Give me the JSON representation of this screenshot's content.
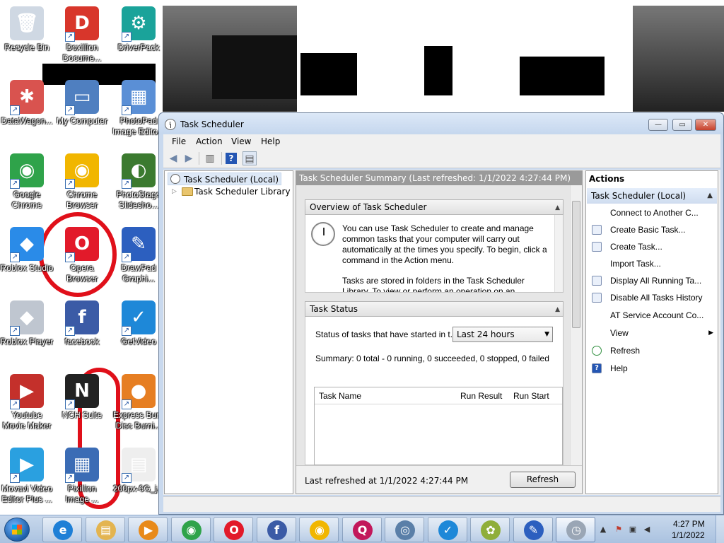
{
  "desktop": {
    "icons": [
      {
        "label": "Recycle Bin",
        "color": "#cfd8e3",
        "glyph": "🗑"
      },
      {
        "label": "Doxillion Docume...",
        "color": "#d8362b",
        "glyph": "D"
      },
      {
        "label": "DriverPack",
        "color": "#1aa39a",
        "glyph": "⚙"
      },
      {
        "label": "DataWagon...",
        "color": "#d9534f",
        "glyph": "✱"
      },
      {
        "label": "My Computer",
        "color": "#4f7fc0",
        "glyph": "▭"
      },
      {
        "label": "PhotoPad Image Edito...",
        "color": "#5a8fd6",
        "glyph": "▦"
      },
      {
        "label": "Google Chrome",
        "color": "#2fa34a",
        "glyph": "◉"
      },
      {
        "label": "Chrome Browser",
        "color": "#f1b600",
        "glyph": "◉"
      },
      {
        "label": "PhotoStage Slidesho...",
        "color": "#3b7a2f",
        "glyph": "◐"
      },
      {
        "label": "Roblox Studio",
        "color": "#2a8be8",
        "glyph": "◆"
      },
      {
        "label": "Opera Browser",
        "color": "#e21a2a",
        "glyph": "O"
      },
      {
        "label": "DrawPad Graphi...",
        "color": "#2c5fbf",
        "glyph": "✎"
      },
      {
        "label": "Roblox Player",
        "color": "#bfc6d0",
        "glyph": "◆"
      },
      {
        "label": "facebook",
        "color": "#3b5ba6",
        "glyph": "f"
      },
      {
        "label": "GetVideo",
        "color": "#1e88d8",
        "glyph": "✓"
      },
      {
        "label": "Youtube Movie Maker",
        "color": "#c4302b",
        "glyph": "▶"
      },
      {
        "label": "NCH Suite",
        "color": "#222222",
        "glyph": "N"
      },
      {
        "label": "Express Burn Disc Burni...",
        "color": "#e67e22",
        "glyph": "●"
      },
      {
        "label": "Movavi Video Editor Plus ...",
        "color": "#2aa0e0",
        "glyph": "▶"
      },
      {
        "label": "Pixillion Image ...",
        "color": "#3b6cb5",
        "glyph": "▦"
      },
      {
        "label": "200px-6G_j...",
        "color": "#eeeeee",
        "glyph": "▤"
      }
    ]
  },
  "window": {
    "title": "Task Scheduler",
    "controls": {
      "minimize": "—",
      "maximize": "▭",
      "close": "✕"
    },
    "menu": [
      "File",
      "Action",
      "View",
      "Help"
    ],
    "toolbar_icons": [
      "back-arrow-icon",
      "forward-arrow-icon",
      "show-hide-console-tree-icon",
      "help-icon",
      "show-hide-action-pane-icon"
    ],
    "tree": {
      "root": "Task Scheduler (Local)",
      "library": "Task Scheduler Library"
    },
    "summary": {
      "header": "Task Scheduler Summary (Last refreshed: 1/1/2022 4:27:44 PM)",
      "overview": {
        "title": "Overview of Task Scheduler",
        "para1": "You can use Task Scheduler to create and manage common tasks that your computer will carry out automatically at the times you specify. To begin, click a command in the Action menu.",
        "para2": "Tasks are stored in folders in the Task Scheduler Library. To view or perform an operation on an"
      },
      "status": {
        "title": "Task Status",
        "label": "Status of tasks that have started in t...",
        "range": "Last 24 hours",
        "summary": "Summary: 0 total - 0 running, 0 succeeded, 0 stopped, 0 failed",
        "columns": [
          "Task Name",
          "Run Result",
          "Run Start"
        ]
      },
      "footer": {
        "last_refreshed": "Last refreshed at 1/1/2022 4:27:44 PM",
        "refresh_button": "Refresh"
      }
    },
    "actions": {
      "title": "Actions",
      "group": "Task Scheduler (Local)",
      "items": [
        "Connect to Another C...",
        "Create Basic Task...",
        "Create Task...",
        "Import Task...",
        "Display All Running Ta...",
        "Disable All Tasks History",
        "AT Service Account Co...",
        "View",
        "Refresh",
        "Help"
      ]
    }
  },
  "taskbar": {
    "apps": [
      {
        "name": "internet-explorer",
        "glyph": "e",
        "color": "#1e7fd6"
      },
      {
        "name": "windows-explorer",
        "glyph": "▤",
        "color": "#e3b450"
      },
      {
        "name": "media-player",
        "glyph": "▶",
        "color": "#e88a1a"
      },
      {
        "name": "chrome",
        "glyph": "◉",
        "color": "#2fa34a"
      },
      {
        "name": "opera",
        "glyph": "O",
        "color": "#e21a2a"
      },
      {
        "name": "facebook",
        "glyph": "f",
        "color": "#3b5ba6"
      },
      {
        "name": "chrome-browser",
        "glyph": "◉",
        "color": "#f1b600"
      },
      {
        "name": "q-app",
        "glyph": "Q",
        "color": "#c2185b"
      },
      {
        "name": "disc-app",
        "glyph": "◎",
        "color": "#5a7fa8"
      },
      {
        "name": "getvideo",
        "glyph": "✓",
        "color": "#1e88d8"
      },
      {
        "name": "paint",
        "glyph": "✿",
        "color": "#8fae3a"
      },
      {
        "name": "drawpad",
        "glyph": "✎",
        "color": "#2c5fbf"
      },
      {
        "name": "task-scheduler",
        "glyph": "◷",
        "color": "#9aa6b5"
      }
    ],
    "clock": {
      "time": "4:27 PM",
      "date": "1/1/2022"
    }
  }
}
